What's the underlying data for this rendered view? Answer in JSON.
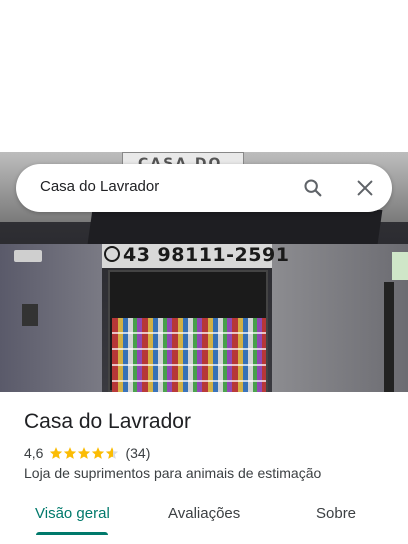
{
  "search": {
    "query": "Casa do Lavrador"
  },
  "photo": {
    "sign_text": "CASA DO",
    "phone_text": "43 98111-2591"
  },
  "place": {
    "title": "Casa do Lavrador",
    "rating": "4,6",
    "stars": 4.6,
    "review_count": "(34)",
    "category": "Loja de suprimentos para animais de estimação"
  },
  "tabs": [
    {
      "label": "Visão geral",
      "active": true
    },
    {
      "label": "Avaliações",
      "active": false
    },
    {
      "label": "Sobre",
      "active": false
    }
  ],
  "colors": {
    "accent": "#00796b",
    "star": "#fbbc04"
  },
  "icons": [
    "search-icon",
    "close-icon",
    "star-icon",
    "whatsapp-icon"
  ]
}
